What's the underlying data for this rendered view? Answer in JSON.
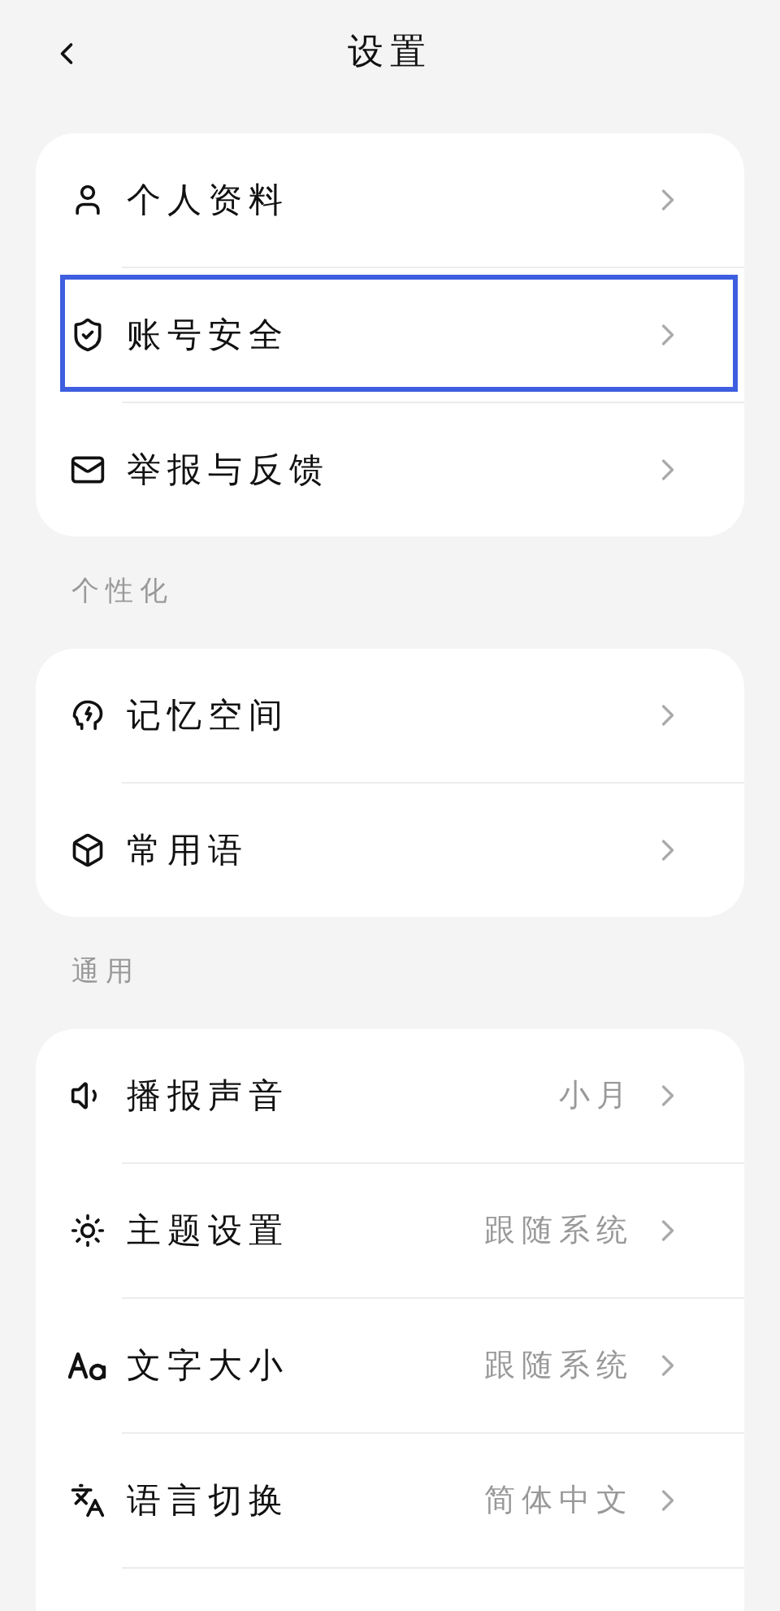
{
  "header": {
    "title": "设置"
  },
  "sections": [
    {
      "items": [
        {
          "label": "个人资料",
          "highlighted": false
        },
        {
          "label": "账号安全",
          "highlighted": true
        },
        {
          "label": "举报与反馈",
          "highlighted": false
        }
      ]
    },
    {
      "heading": "个性化",
      "items": [
        {
          "label": "记忆空间",
          "highlighted": false
        },
        {
          "label": "常用语",
          "highlighted": false
        }
      ]
    },
    {
      "heading": "通用",
      "items": [
        {
          "label": "播报声音",
          "value": "小月",
          "highlighted": false
        },
        {
          "label": "主题设置",
          "value": "跟随系统",
          "highlighted": false
        },
        {
          "label": "文字大小",
          "value": "跟随系统",
          "highlighted": false
        },
        {
          "label": "语言切换",
          "value": "简体中文",
          "highlighted": false
        }
      ]
    }
  ]
}
